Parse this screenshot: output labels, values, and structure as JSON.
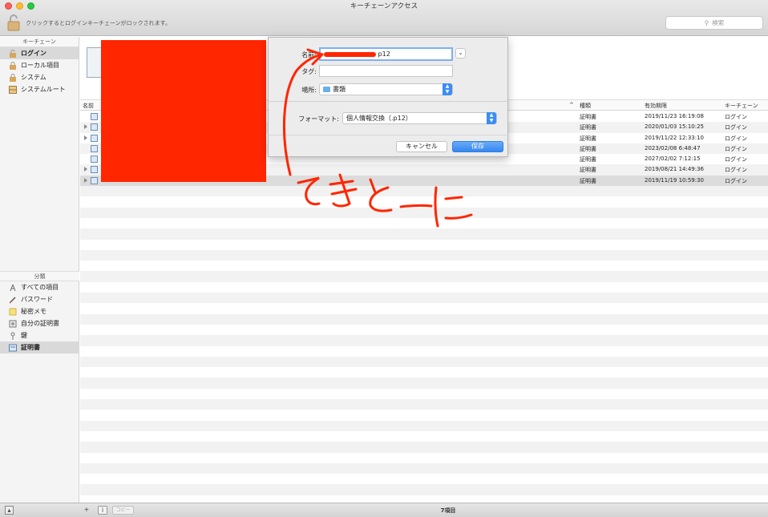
{
  "window": {
    "title": "キーチェーンアクセス",
    "lock_message": "クリックするとログインキーチェーンがロックされます。",
    "search_placeholder": "検索"
  },
  "sidebar": {
    "keychains_header": "キーチェーン",
    "keychains": [
      {
        "label": "ログイン",
        "icon": "lock-open-icon",
        "selected": true
      },
      {
        "label": "ローカル項目",
        "icon": "lock-icon"
      },
      {
        "label": "システム",
        "icon": "lock-icon"
      },
      {
        "label": "システムルート",
        "icon": "cabinet-icon"
      }
    ],
    "categories_header": "分類",
    "categories": [
      {
        "label": "すべての項目",
        "icon": "all-items-icon"
      },
      {
        "label": "パスワード",
        "icon": "pencil-icon"
      },
      {
        "label": "秘密メモ",
        "icon": "note-icon"
      },
      {
        "label": "自分の証明書",
        "icon": "my-cert-icon"
      },
      {
        "label": "鍵",
        "icon": "key-icon"
      },
      {
        "label": "証明書",
        "icon": "certificate-icon",
        "selected": true
      }
    ]
  },
  "table": {
    "headers": {
      "name": "名前",
      "kind": "種類",
      "expires": "有効期限",
      "keychain": "キーチェーン"
    },
    "rows": [
      {
        "kind": "証明書",
        "expires": "2019/11/23 16:19:08",
        "keychain": "ログイン",
        "disclosure": false
      },
      {
        "kind": "証明書",
        "expires": "2020/01/03 15:10:25",
        "keychain": "ログイン",
        "disclosure": true
      },
      {
        "kind": "証明書",
        "expires": "2019/11/22 12:33:10",
        "keychain": "ログイン",
        "disclosure": true
      },
      {
        "kind": "証明書",
        "expires": "2023/02/08 6:48:47",
        "keychain": "ログイン",
        "disclosure": false
      },
      {
        "kind": "証明書",
        "expires": "2027/02/02 7:12:15",
        "keychain": "ログイン",
        "disclosure": false
      },
      {
        "kind": "証明書",
        "expires": "2019/08/21 14:49:36",
        "keychain": "ログイン",
        "disclosure": true
      },
      {
        "kind": "証明書",
        "expires": "2019/11/19 10:59:30",
        "keychain": "ログイン",
        "disclosure": true,
        "selected": true
      }
    ],
    "empty_rows": 30
  },
  "dialog": {
    "name_label": "名前:",
    "name_value": "p12",
    "tag_label": "タグ:",
    "tag_value": "",
    "location_label": "場所:",
    "location_value": "書類",
    "format_label": "フォーマット:",
    "format_value": "個人情報交換（.p12）",
    "cancel_label": "キャンセル",
    "save_label": "保存"
  },
  "annotation": {
    "handwritten_text": "てきとーに",
    "color": "#ff2600"
  },
  "bottombar": {
    "add_label": "+",
    "info_label": "i",
    "copy_label": "コピー",
    "item_count": "7項目"
  },
  "colors": {
    "accent": "#3587f0",
    "redaction": "#ff2600"
  }
}
